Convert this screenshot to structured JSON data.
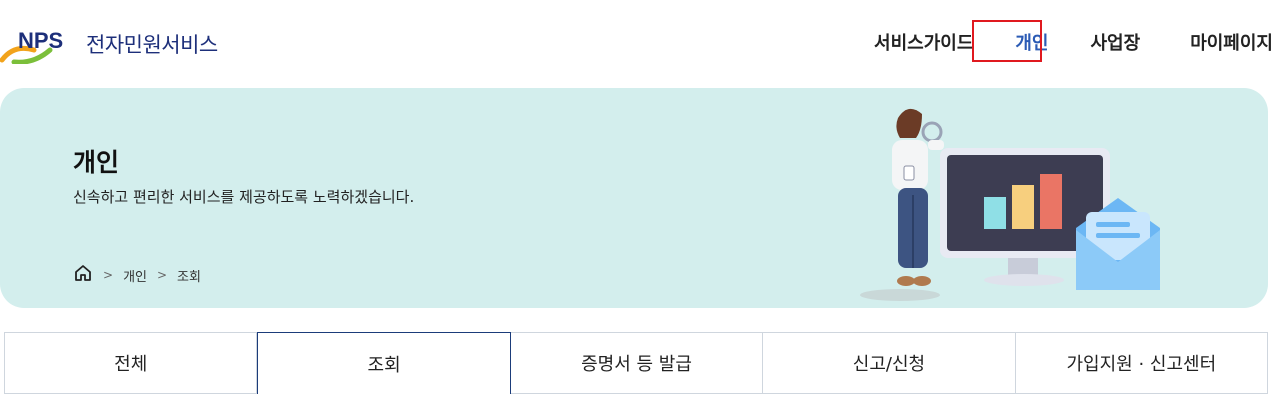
{
  "header": {
    "logo_text": "NPS",
    "service_name": "전자민원서비스",
    "nav": [
      "서비스가이드",
      "개인",
      "사업장",
      "마이페이지"
    ],
    "active_nav": "개인"
  },
  "hero": {
    "title": "개인",
    "description": "신속하고 편리한 서비스를 제공하도록 노력하겠습니다.",
    "breadcrumb": [
      "개인",
      "조회"
    ]
  },
  "tabs": [
    "전체",
    "조회",
    "증명서 등 발급",
    "신고/신청",
    "가입지원 · 신고센터"
  ],
  "active_tab": "조회",
  "colors": {
    "brand_blue": "#1d2f7a",
    "active_nav": "#2b5bb5",
    "hero_bg": "#d3eeed",
    "highlight": "#e0191f"
  }
}
